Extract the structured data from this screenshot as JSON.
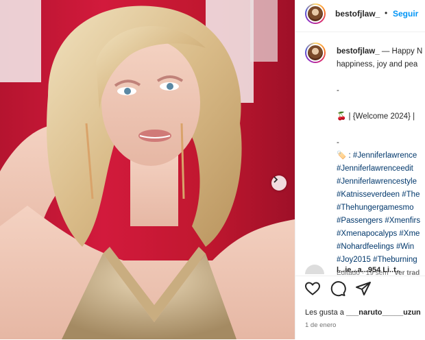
{
  "post": {
    "username": "bestofjlaw_",
    "follow_separator": "•",
    "follow_label": "Seguir"
  },
  "caption": {
    "username": "bestofjlaw_",
    "lines": [
      "— Happy N",
      "happiness, joy and pea",
      "",
      "-",
      "",
      "| {Welcome 2024} |",
      "",
      "-",
      ": #Jenniferlawrence",
      "#Jenniferlawrenceedit",
      "#Jenniferlawrencestyle",
      "#Katnisseverdeen #The",
      "#Thehungergamesmo",
      "#Passengers #Xmenfirs",
      "#Xmenapocalyps #Xme",
      "#Nohardfeelings #Win",
      "#Joy2015 #Theburning"
    ],
    "cherry_emoji": "🍒",
    "tag_emoji": "🏷️",
    "edited": "Editado · 19 sem",
    "see_translation": "Ver trad"
  },
  "next_comment": {
    "text": "l...ie...a...954 Li..t.."
  },
  "actions": {
    "like_icon": "heart-icon",
    "comment_icon": "comment-icon",
    "share_icon": "share-icon"
  },
  "likes": {
    "prefix": "Les gusta a",
    "user": "___naruto_____uzun"
  },
  "date": "1 de enero",
  "colors": {
    "accent": "#0095f6",
    "hashtag": "#00376b",
    "backdrop": "#c0172f"
  }
}
